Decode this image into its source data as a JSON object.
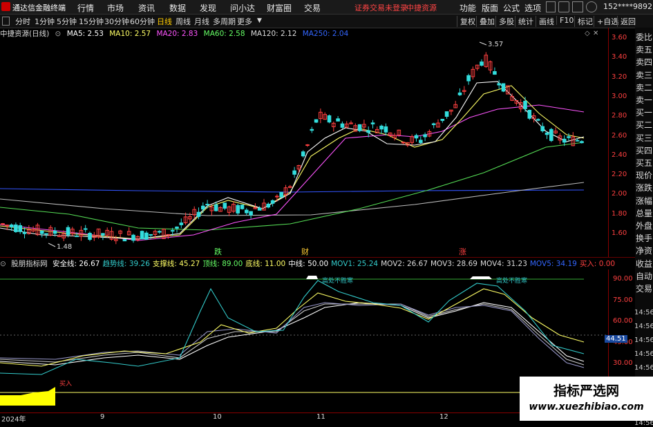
{
  "menubar": {
    "app": "通达信金融终端",
    "items": [
      "行情",
      "市场",
      "资讯",
      "数据",
      "发现",
      "问小达",
      "财富圈",
      "交易"
    ],
    "warn": "证券交易未登录",
    "broker": "中捷资源",
    "right": [
      "功能",
      "版面",
      "公式",
      "选项"
    ],
    "account": "152****9892"
  },
  "toolbar": {
    "periods": [
      "分时",
      "1分钟",
      "5分钟",
      "15分钟",
      "30分钟",
      "60分钟",
      "日线",
      "周线",
      "月线",
      "多周期",
      "更多"
    ],
    "active_period": "日线",
    "tools": [
      "复权",
      "叠加",
      "多股",
      "统计",
      "画线",
      "F10",
      "标记",
      "+自选",
      "返回"
    ]
  },
  "main_legend": {
    "title": "中捷资源(日线)",
    "ma": [
      {
        "label": "MA5: 2.53",
        "color": "#ffffff"
      },
      {
        "label": "MA10: 2.57",
        "color": "#ffff66"
      },
      {
        "label": "MA20: 2.83",
        "color": "#ff55ff"
      },
      {
        "label": "MA60: 2.58",
        "color": "#66ff66"
      },
      {
        "label": "MA120: 2.12",
        "color": "#dddddd"
      },
      {
        "label": "MA250: 2.04",
        "color": "#3366ff"
      }
    ]
  },
  "price_axis": [
    "3.60",
    "3.40",
    "3.20",
    "3.00",
    "2.80",
    "2.60",
    "2.40",
    "2.20",
    "2.00",
    "1.80",
    "1.60"
  ],
  "annotations": {
    "high": "3.57",
    "low": "1.48",
    "markers": [
      "跌",
      "财",
      "涨"
    ]
  },
  "indicator_legend": {
    "title": "股朋指标网",
    "items": [
      {
        "label": "安全线: 26.67",
        "color": "#ffffff"
      },
      {
        "label": "趋势线: 39.26",
        "color": "#33cccc"
      },
      {
        "label": "支撑线: 45.27",
        "color": "#ffff66"
      },
      {
        "label": "顶线: 89.00",
        "color": "#66ff66"
      },
      {
        "label": "底线: 11.00",
        "color": "#ffff66"
      },
      {
        "label": "中线: 50.00",
        "color": "#ffffff"
      },
      {
        "label": "MOV1: 25.24",
        "color": "#33cccc"
      },
      {
        "label": "MOV2: 26.67",
        "color": "#dddddd"
      },
      {
        "label": "MOV3: 28.69",
        "color": "#dddddd"
      },
      {
        "label": "MOV4: 31.23",
        "color": "#dddddd"
      },
      {
        "label": "MOV5: 34.19",
        "color": "#3366ff"
      },
      {
        "label": "买入: 0.00",
        "color": "#ff4040"
      }
    ],
    "top_label": "高处不胜寒",
    "buy_mark": "买入"
  },
  "ind_axis": [
    "90.00",
    "75.00",
    "60.00",
    "45.00",
    "30.00"
  ],
  "ind_current": "44.51",
  "x_labels": [
    "2024年",
    "9",
    "10",
    "11",
    "12"
  ],
  "side_tabs": [
    "委比",
    "卖五",
    "卖四",
    "卖三",
    "卖二",
    "卖一",
    "买一",
    "买二",
    "买三",
    "买四",
    "买五",
    "现价",
    "涨跌",
    "涨幅",
    "总量",
    "外盘",
    "换手",
    "净资",
    "收益",
    "自动",
    "交易"
  ],
  "side_times": [
    "14:56",
    "14:56",
    "14:56",
    "14:56",
    "14:56",
    "14:56",
    "14:56",
    "14:56",
    "14:56"
  ],
  "watermark": {
    "line1": "指标严选网",
    "line2": "www.xuezhibiao.com"
  }
}
